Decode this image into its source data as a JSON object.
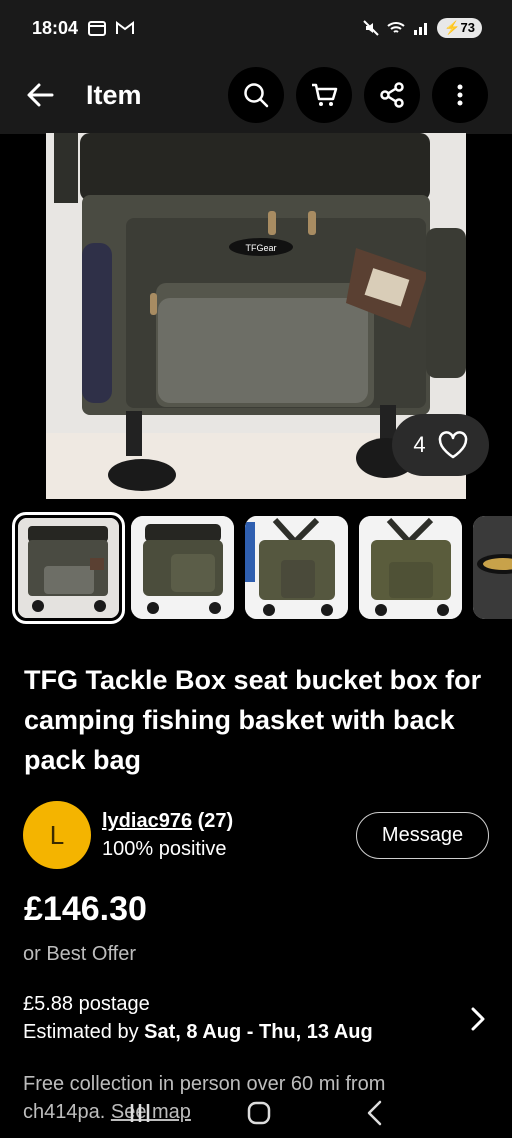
{
  "status_bar": {
    "time": "18:04",
    "battery": "73"
  },
  "app_bar": {
    "title": "Item",
    "icons": [
      "back-arrow-icon",
      "search-icon",
      "cart-icon",
      "share-icon",
      "more-vertical-icon"
    ]
  },
  "gallery": {
    "favorite_count": "4",
    "selected_index": 0,
    "thumbnail_count": 5
  },
  "listing": {
    "title": "TFG Tackle Box seat bucket box for camping fishing basket with back pack bag"
  },
  "seller": {
    "initial": "L",
    "name": "lydiac976",
    "feedback_count": "(27)",
    "positive": "100% positive",
    "message_label": "Message",
    "avatar_color": "#f4b400"
  },
  "price": {
    "amount": "£146.30",
    "best_offer": "or Best Offer"
  },
  "shipping": {
    "postage": "£5.88 postage",
    "estimated_prefix": "Estimated by ",
    "estimated_dates": "Sat, 8 Aug - Thu, 13 Aug"
  },
  "collection": {
    "text": "Free collection in person over 60 mi from ch414pa. ",
    "link": "See map"
  }
}
